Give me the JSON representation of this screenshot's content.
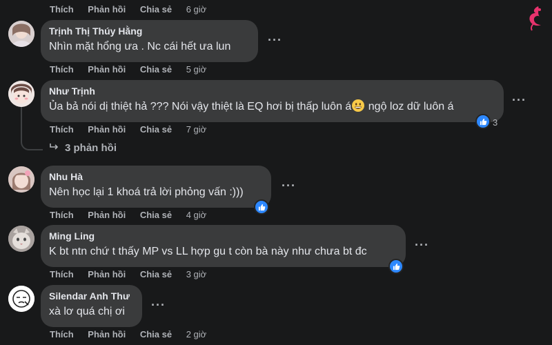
{
  "actions": {
    "like": "Thích",
    "reply": "Phản hồi",
    "share": "Chia sẻ"
  },
  "top_row": {
    "time": "6 giờ"
  },
  "comments": [
    {
      "author": "Trịnh Thị Thúy Hằng",
      "text": "Nhìn mặt hổng ưa . Nc cái hết ưa lun",
      "time": "5 giờ"
    },
    {
      "author": "Như Trịnh",
      "text_before": "Ủa bả nói dị thiệt hả ??? Nói vậy thiệt là EQ hơi bị thấp luôn á",
      "text_after": " ngộ loz dữ luôn á",
      "time": "7 giờ",
      "reaction_count": "3",
      "replies_label": "3 phản hồi"
    },
    {
      "author": "Nhu Hà",
      "text": "Nên học lại 1 khoá trả lời phỏng vấn :)))",
      "time": "4 giờ"
    },
    {
      "author": "Ming Ling",
      "text": "K bt ntn chứ t thấy MP vs LL hợp gu t còn bà này như chưa bt đc",
      "time": "3 giờ"
    },
    {
      "author": "Silendar Anh Thư",
      "text": "xà lơ quá chị ơi",
      "time": "2 giờ"
    }
  ],
  "colors": {
    "background": "#18191a",
    "bubble": "#3a3b3c",
    "like_blue": "#2d88ff",
    "logo": "#e8336d"
  },
  "icons": {
    "more": "more-options-icon",
    "reply_arrow": "reply-arrow-icon",
    "like": "like-thumb-icon",
    "logo": "brand-logo-icon"
  }
}
